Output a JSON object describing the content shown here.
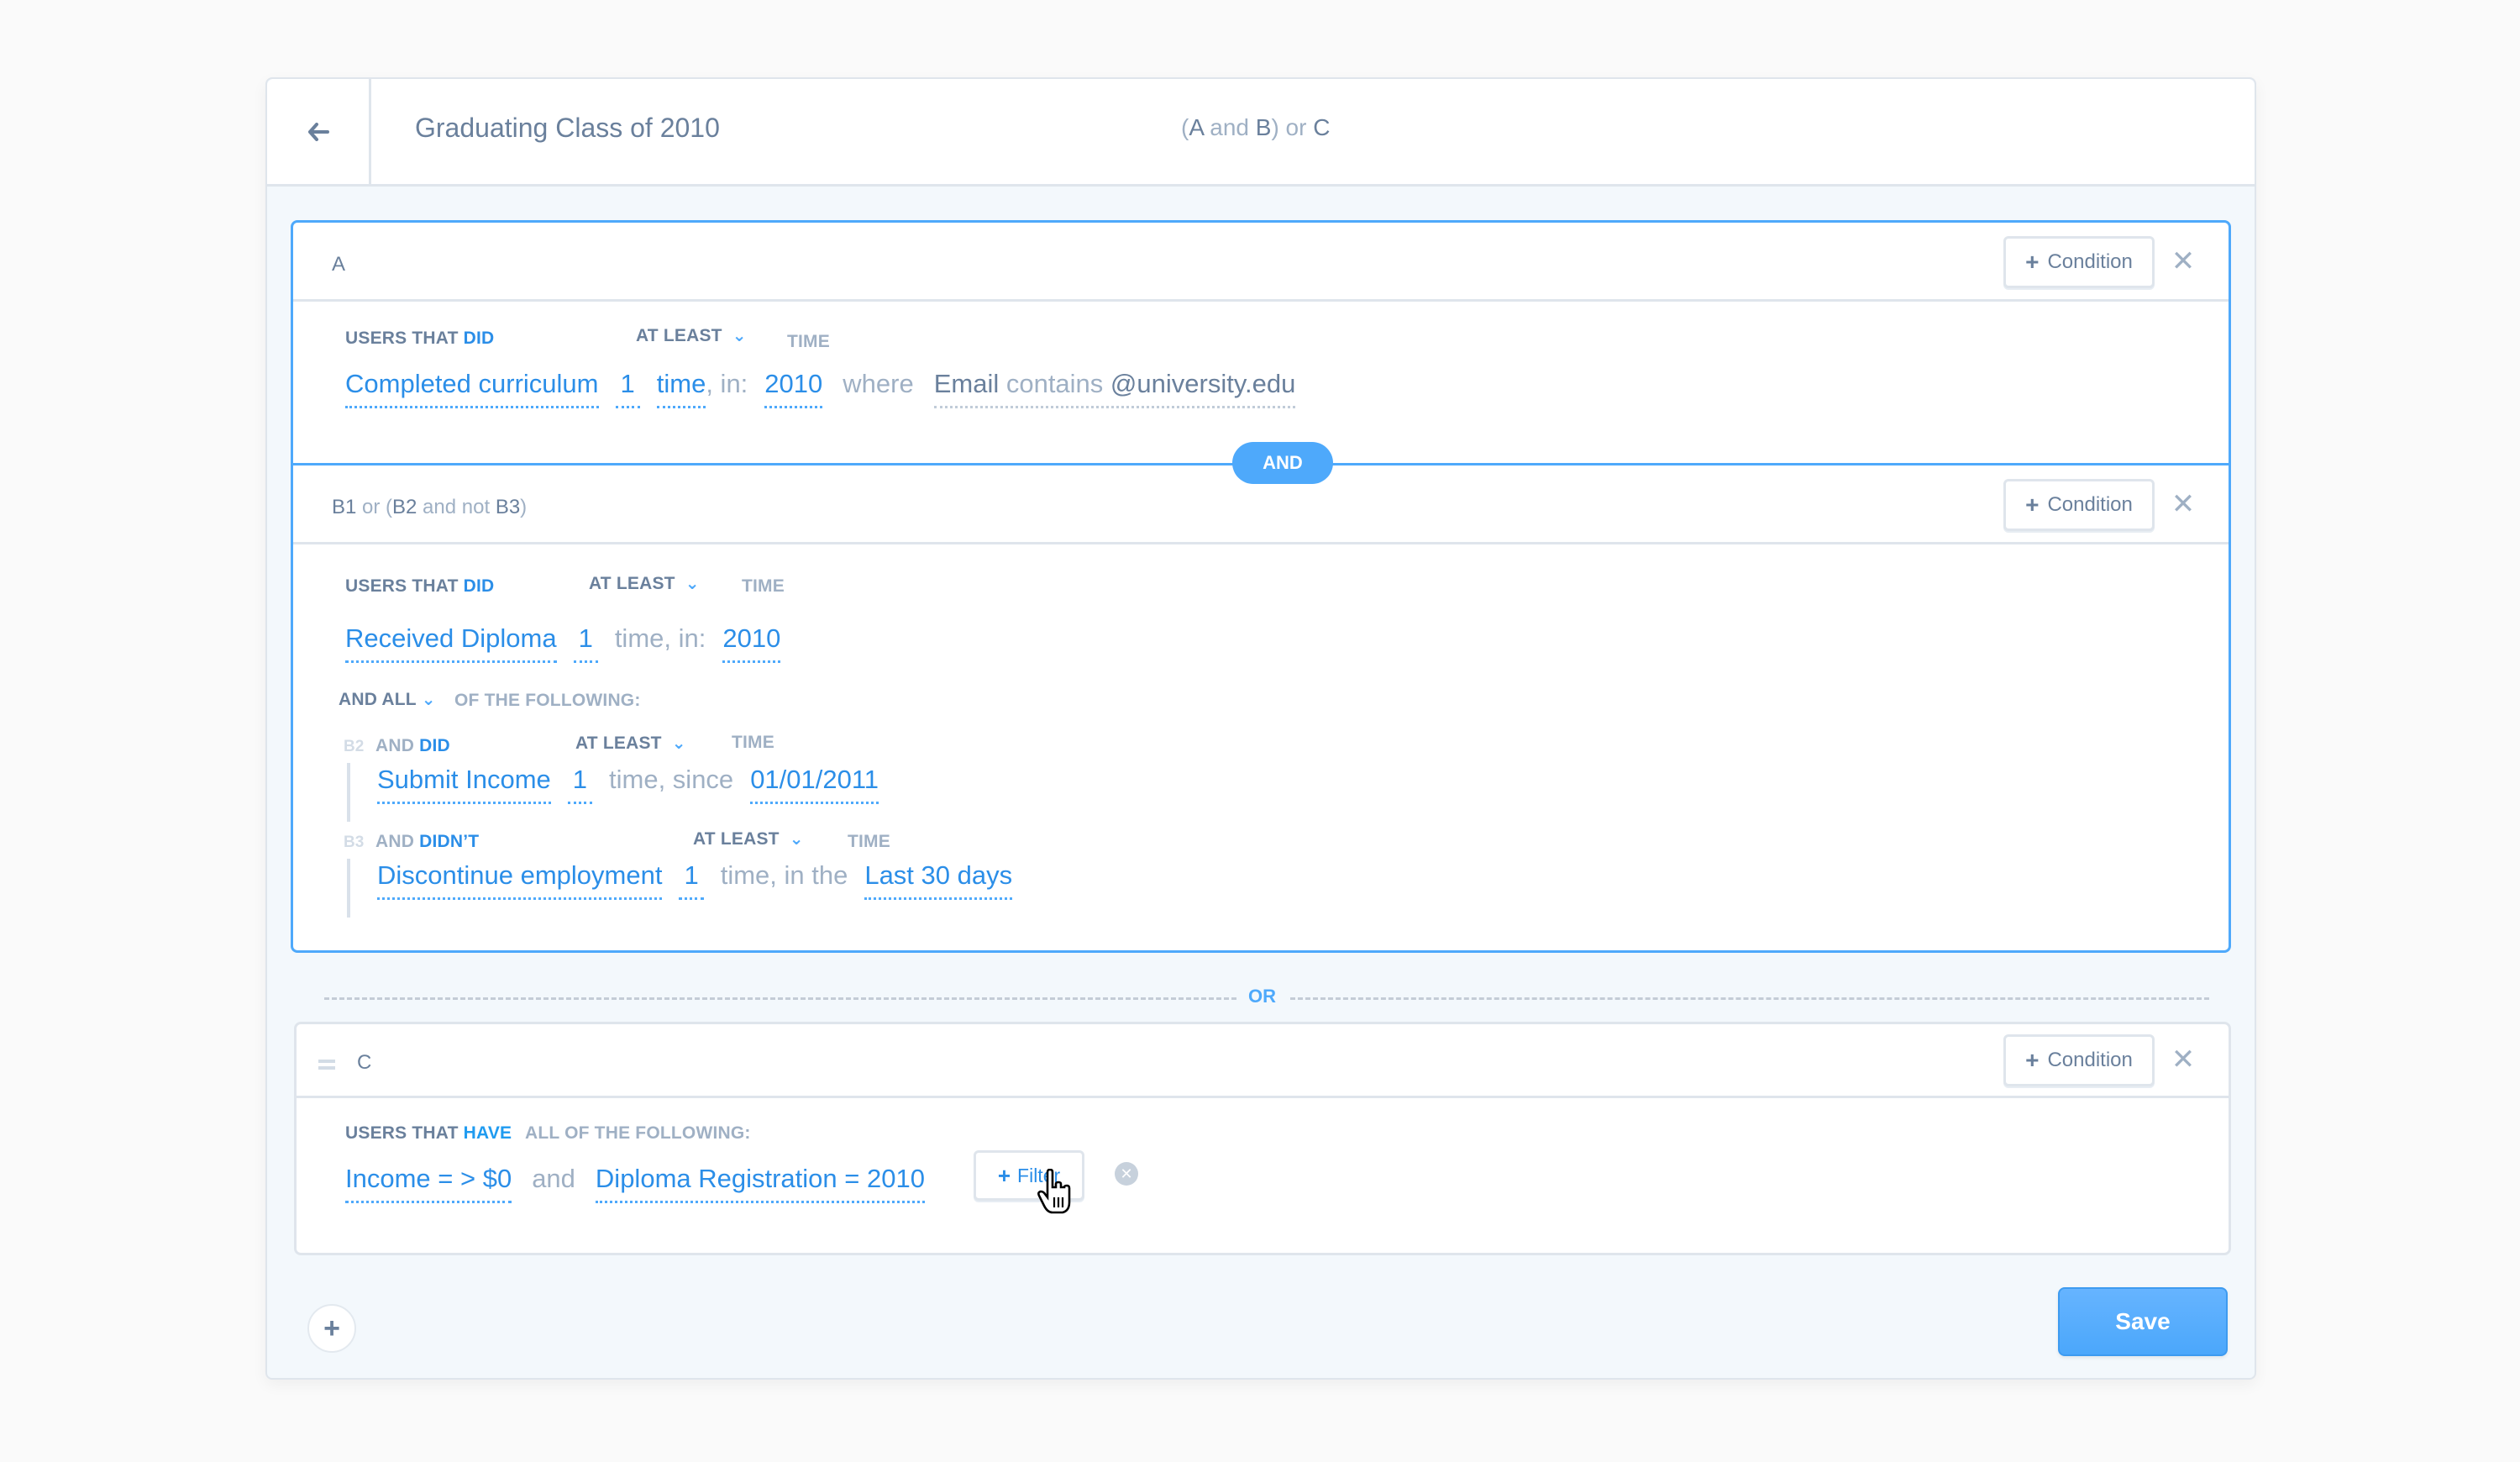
{
  "header": {
    "title": "Graduating Class of 2010",
    "formula": {
      "open": "(",
      "a": "A",
      "and": " and ",
      "b": "B",
      "close_or": ") or ",
      "c": "C"
    }
  },
  "icons": {
    "back": "arrow-left-icon",
    "close": "✕",
    "plus": "+",
    "chevron": "⌄",
    "clear": "✕"
  },
  "condition_button_label": "Condition",
  "groups": {
    "a": {
      "label": "A",
      "users_that": "USERS THAT ",
      "verb": "DID",
      "at_least": "AT LEAST",
      "time": "TIME",
      "event": "Completed curriculum",
      "count": "1",
      "time_word": "time",
      "in_word": ", in:",
      "period": "2010",
      "where": "where",
      "filter": {
        "prop": "Email",
        "op": " contains ",
        "value": "@university.edu"
      }
    },
    "and_pill": "AND",
    "b": {
      "label_b1": "B1",
      "label_or": " or (",
      "label_b2": "B2",
      "label_and_not": " and not ",
      "label_b3": "B3",
      "label_close": ")",
      "users_that": "USERS THAT ",
      "verb": "DID",
      "at_least": "AT LEAST",
      "time": "TIME",
      "event": "Received Diploma",
      "count": "1",
      "time_in": "time, in:",
      "period": "2010",
      "and_all": "AND ALL",
      "of_following": "OF THE FOLLOWING:",
      "subs": [
        {
          "tag": "B2",
          "and": "AND ",
          "verb": "DID",
          "at_least": "AT LEAST",
          "time": "TIME",
          "event": "Submit Income",
          "count": "1",
          "connector": "time, since",
          "period": "01/01/2011"
        },
        {
          "tag": "B3",
          "and": "AND ",
          "verb": "DIDN’T",
          "at_least": "AT LEAST",
          "time": "TIME",
          "event": "Discontinue employment",
          "count": "1",
          "connector": "time, in the",
          "period": "Last 30 days"
        }
      ]
    },
    "or_separator": "OR",
    "c": {
      "label": "C",
      "users_that": "USERS THAT ",
      "verb": "HAVE",
      "all_following": "ALL OF THE FOLLOWING:",
      "filters": [
        "Income = > $0",
        "Diploma Registration = 2010"
      ],
      "joiner": "and",
      "filter_button": "Filter"
    }
  },
  "footer": {
    "save_label": "Save"
  }
}
